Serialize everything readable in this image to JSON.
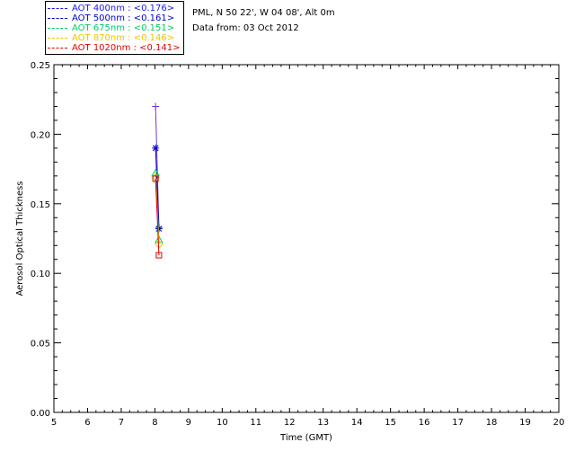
{
  "header": {
    "site_line": "PML, N 50 22', W 04 08', Alt 0m",
    "date_line": "Data from: 03 Oct 2012"
  },
  "legend": [
    {
      "label": "AOT  400nm : <0.176>",
      "color": "#1a1ae6"
    },
    {
      "label": "AOT  500nm : <0.161>",
      "color": "#0000cc"
    },
    {
      "label": "AOT  675nm : <0.151>",
      "color": "#00cc66"
    },
    {
      "label": "AOT  870nm : <0.146>",
      "color": "#e6c800"
    },
    {
      "label": "AOT 1020nm : <0.141>",
      "color": "#e60000"
    }
  ],
  "chart_data": {
    "type": "line",
    "xlabel": "Time (GMT)",
    "ylabel": "Aerosol Optical Thickness",
    "xlim": [
      5,
      20
    ],
    "ylim": [
      0.0,
      0.25
    ],
    "xticks": [
      5,
      6,
      7,
      8,
      9,
      10,
      11,
      12,
      13,
      14,
      15,
      16,
      17,
      18,
      19,
      20
    ],
    "yticks": [
      "0.00",
      "0.05",
      "0.10",
      "0.15",
      "0.20",
      "0.25"
    ],
    "grid": false,
    "series": [
      {
        "name": "AOT  400nm",
        "color": "#6a3cc8",
        "marker": "plus",
        "x": [
          8.02,
          8.12
        ],
        "y": [
          0.22,
          0.133
        ]
      },
      {
        "name": "AOT  500nm",
        "color": "#0000cc",
        "marker": "asterisk",
        "x": [
          8.02,
          8.12
        ],
        "y": [
          0.19,
          0.132
        ]
      },
      {
        "name": "AOT  675nm",
        "color": "#00cc66",
        "marker": "triangle",
        "x": [
          8.02,
          8.12
        ],
        "y": [
          0.172,
          0.124
        ]
      },
      {
        "name": "AOT  870nm",
        "color": "#e6c800",
        "marker": "diamond",
        "x": [
          8.02,
          8.12
        ],
        "y": [
          0.169,
          0.121
        ]
      },
      {
        "name": "AOT 1020nm",
        "color": "#e60000",
        "marker": "square",
        "x": [
          8.02,
          8.12
        ],
        "y": [
          0.168,
          0.113
        ]
      }
    ]
  }
}
